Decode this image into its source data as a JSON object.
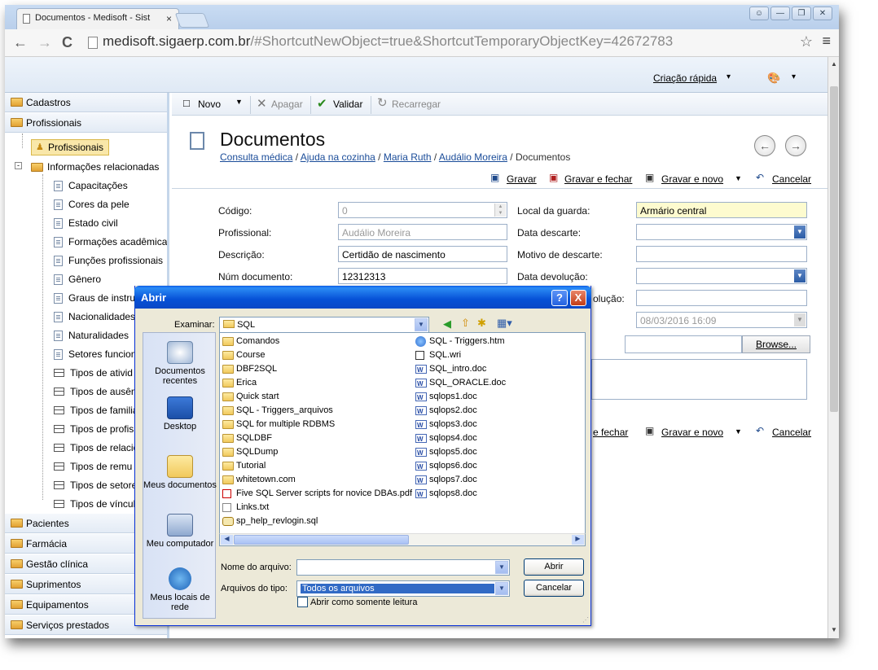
{
  "browser": {
    "tab_title": "Documentos - Medisoft - Sist",
    "tab_close": "×",
    "url_host": "medisoft.sigaerp.com.br",
    "url_rest": "/#ShortcutNewObject=true&ShortcutTemporaryObjectKey=42672783",
    "back": "←",
    "forward": "→",
    "reload": "C",
    "star": "☆",
    "menu": "≡"
  },
  "header": {
    "quick_create": "Criação rápida",
    "dropdown_arrow": "▾"
  },
  "sidebar": {
    "accordions_top": [
      "Cadastros",
      "Profissionais"
    ],
    "selected": "Profissionais",
    "related_group": "Informações relacionadas",
    "related_items": [
      "Capacitações",
      "Cores da pele",
      "Estado civil",
      "Formações acadêmicas",
      "Funções profissionais",
      "Gênero",
      "Graus de instru",
      "Nacionalidades",
      "Naturalidades",
      "Setores funcion"
    ],
    "table_items": [
      "Tipos de ativid",
      "Tipos de ausên",
      "Tipos de familia",
      "Tipos de profis",
      "Tipos de relacio",
      "Tipos de remu",
      "Tipos de setore",
      "Tipos de víncul"
    ],
    "accordions_bottom": [
      "Pacientes",
      "Farmácia",
      "Gestão clínica",
      "Suprimentos",
      "Equipamentos",
      "Serviços prestados"
    ]
  },
  "toolbar": {
    "new": "Novo",
    "delete": "Apagar",
    "validate": "Validar",
    "reload": "Recarregar"
  },
  "page": {
    "title": "Documentos",
    "breadcrumb": [
      "Consulta médica",
      "Ajuda na cozinha",
      "Maria Ruth",
      "Audálio Moreira"
    ],
    "breadcrumb_current": "Documentos",
    "breadcrumb_sep": "/",
    "actions": {
      "save": "Gravar",
      "save_close": "Gravar e fechar",
      "save_new": "Gravar e novo",
      "cancel": "Cancelar"
    },
    "bottom_actions": {
      "save_close": "e fechar",
      "save_new": "Gravar e novo",
      "cancel": "Cancelar"
    }
  },
  "form": {
    "codigo_label": "Código:",
    "codigo_value": "0",
    "profissional_label": "Profissional:",
    "profissional_value": "Audálio Moreira",
    "descricao_label": "Descrição:",
    "descricao_value": "Certidão de nascimento",
    "num_doc_label": "Núm documento:",
    "num_doc_value": "12312313",
    "local_guarda_label": "Local da guarda:",
    "local_guarda_value": "Armário central",
    "data_descarte_label": "Data descarte:",
    "motivo_descarte_label": "Motivo de descarte:",
    "data_devolucao_label": "Data devolução:",
    "partial_label": "olução:",
    "datetime_value": "08/03/2016 16:09",
    "browse": "Browse..."
  },
  "dialog": {
    "title": "Abrir",
    "help": "?",
    "close": "X",
    "look_in_label": "Examinar:",
    "look_in_value": "SQL",
    "places": [
      "Documentos recentes",
      "Desktop",
      "Meus documentos",
      "Meu computador",
      "Meus locais de rede"
    ],
    "files_col1": [
      {
        "name": "Comandos",
        "type": "folder"
      },
      {
        "name": "Course",
        "type": "folder"
      },
      {
        "name": "DBF2SQL",
        "type": "folder"
      },
      {
        "name": "Erica",
        "type": "folder"
      },
      {
        "name": "Quick start",
        "type": "folder"
      },
      {
        "name": "SQL - Triggers_arquivos",
        "type": "folder"
      },
      {
        "name": "SQL for multiple RDBMS",
        "type": "folder"
      },
      {
        "name": "SQLDBF",
        "type": "folder"
      },
      {
        "name": "SQLDump",
        "type": "folder"
      },
      {
        "name": "Tutorial",
        "type": "folder"
      },
      {
        "name": "whitetown.com",
        "type": "folder"
      },
      {
        "name": "Five SQL Server scripts for novice DBAs.pdf",
        "type": "pdf"
      },
      {
        "name": "Links.txt",
        "type": "txt"
      },
      {
        "name": "sp_help_revlogin.sql",
        "type": "sql"
      }
    ],
    "files_col2": [
      {
        "name": "SQL - Triggers.htm",
        "type": "html"
      },
      {
        "name": "SQL.wri",
        "type": "wri"
      },
      {
        "name": "SQL_intro.doc",
        "type": "doc"
      },
      {
        "name": "SQL_ORACLE.doc",
        "type": "doc"
      },
      {
        "name": "sqlops1.doc",
        "type": "doc"
      },
      {
        "name": "sqlops2.doc",
        "type": "doc"
      },
      {
        "name": "sqlops3.doc",
        "type": "doc"
      },
      {
        "name": "sqlops4.doc",
        "type": "doc"
      },
      {
        "name": "sqlops5.doc",
        "type": "doc"
      },
      {
        "name": "sqlops6.doc",
        "type": "doc"
      },
      {
        "name": "sqlops7.doc",
        "type": "doc"
      },
      {
        "name": "sqlops8.doc",
        "type": "doc"
      }
    ],
    "filename_label": "Nome do arquivo:",
    "filename_value": "",
    "filetype_label": "Arquivos do tipo:",
    "filetype_value": "Todos os arquivos",
    "open_button": "Abrir",
    "cancel_button": "Cancelar",
    "readonly_label": "Abrir como somente leitura"
  }
}
